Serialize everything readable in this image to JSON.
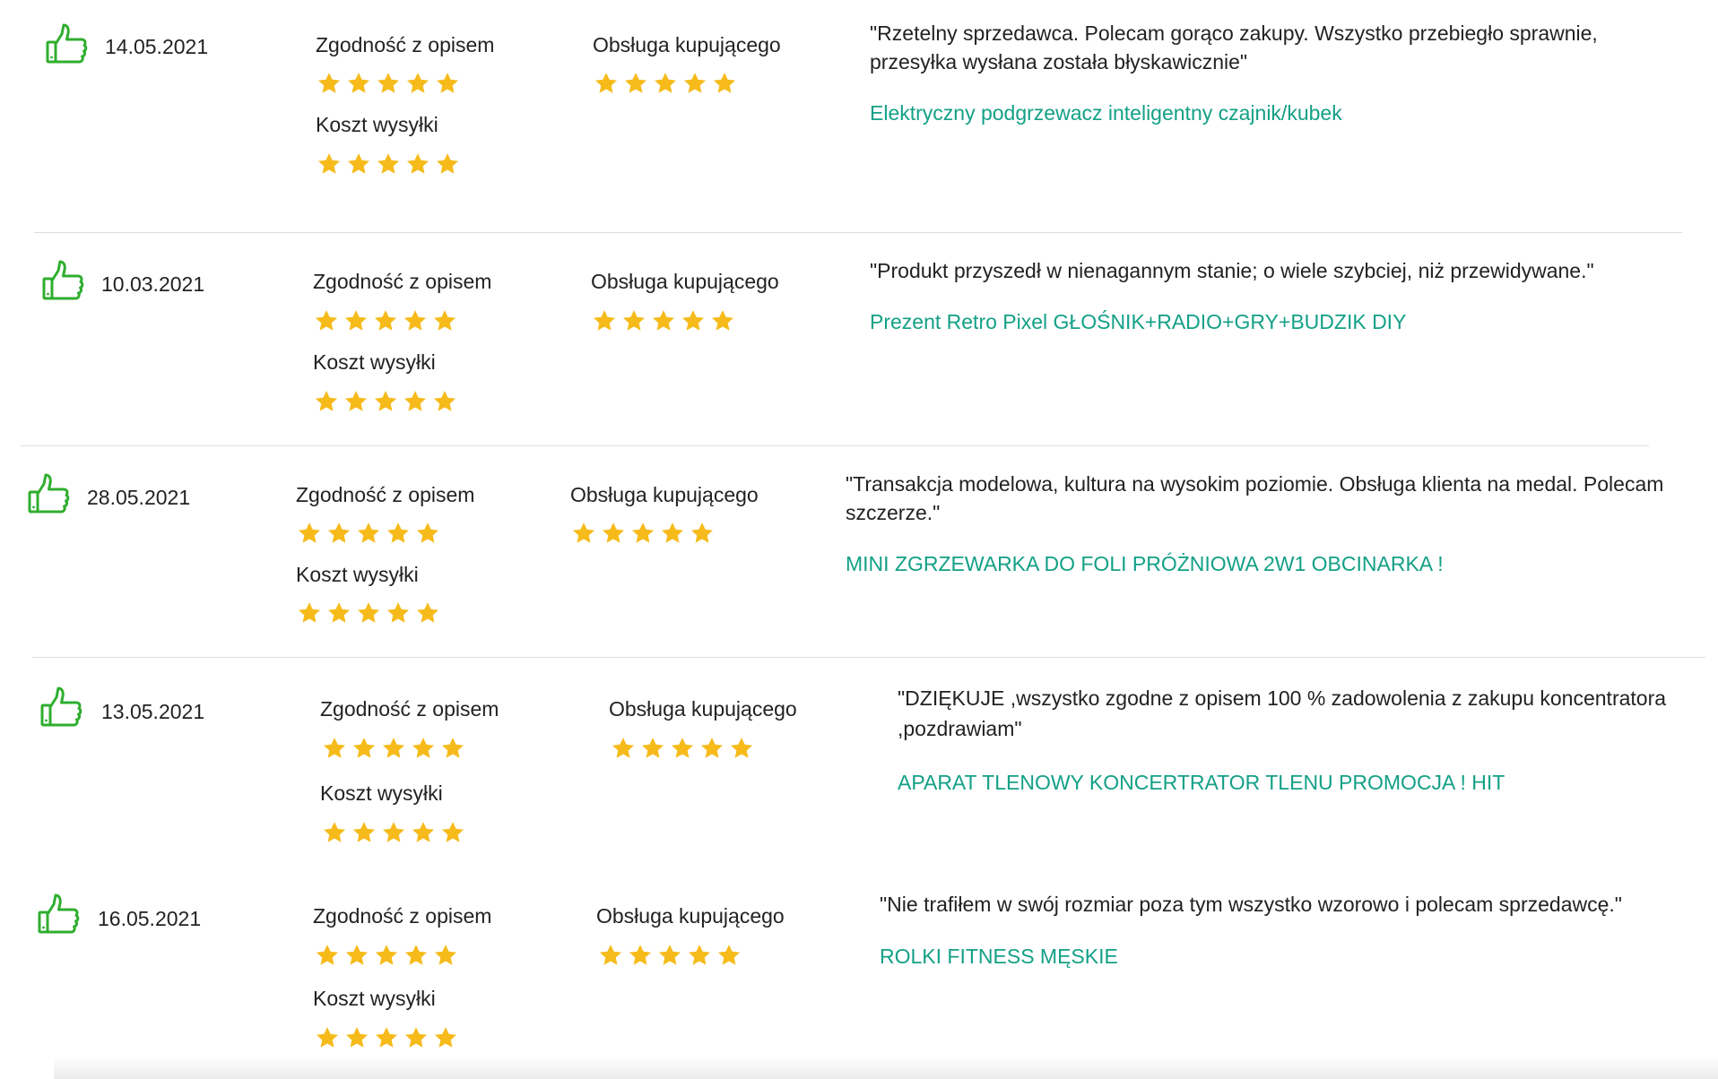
{
  "colors": {
    "accent": "#13a086",
    "star": "#f6bb1b",
    "thumb": "#2fae2f",
    "divider": "#dddddd"
  },
  "icons": {
    "rating_icon": "thumb-up-icon",
    "star_icon": "star-icon"
  },
  "labels": {
    "description_match": "Zgodność z opisem",
    "shipping_cost": "Koszt wysyłki",
    "customer_service": "Obsługa kupującego"
  },
  "reviews": [
    {
      "date": "14.05.2021",
      "rating_description": 5,
      "rating_shipping": 5,
      "rating_service": 5,
      "comment": "\"Rzetelny sprzedawca. Polecam gorąco zakupy. Wszystko przebiegło sprawnie, przesyłka wysłana została błyskawicznie\"",
      "product": "Elektryczny podgrzewacz inteligentny czajnik/kubek"
    },
    {
      "date": "10.03.2021",
      "rating_description": 5,
      "rating_shipping": 5,
      "rating_service": 5,
      "comment": "\"Produkt przyszedł w nienagannym stanie; o wiele szybciej, niż przewidywane.\"",
      "product": "Prezent Retro Pixel GŁOŚNIK+RADIO+GRY+BUDZIK DIY"
    },
    {
      "date": "28.05.2021",
      "rating_description": 5,
      "rating_shipping": 5,
      "rating_service": 5,
      "comment": "\"Transakcja modelowa, kultura na wysokim poziomie. Obsługa klienta na medal. Polecam szczerze.\"",
      "product": "MINI ZGRZEWARKA DO FOLI PRÓŻNIOWA 2W1 OBCINARKA !"
    },
    {
      "date": "13.05.2021",
      "rating_description": 5,
      "rating_shipping": 5,
      "rating_service": 5,
      "comment": "\"DZIĘKUJE ,wszystko zgodne z opisem 100 % zadowolenia z zakupu koncentratora ,pozdrawiam\"",
      "product": "APARAT TLENOWY KONCERTRATOR TLENU PROMOCJA ! HIT"
    },
    {
      "date": "16.05.2021",
      "rating_description": 5,
      "rating_shipping": 5,
      "rating_service": 5,
      "comment": "\"Nie trafiłem w swój rozmiar poza tym wszystko wzorowo i polecam sprzedawcę.\"",
      "product": "ROLKI FITNESS MĘSKIE"
    }
  ]
}
